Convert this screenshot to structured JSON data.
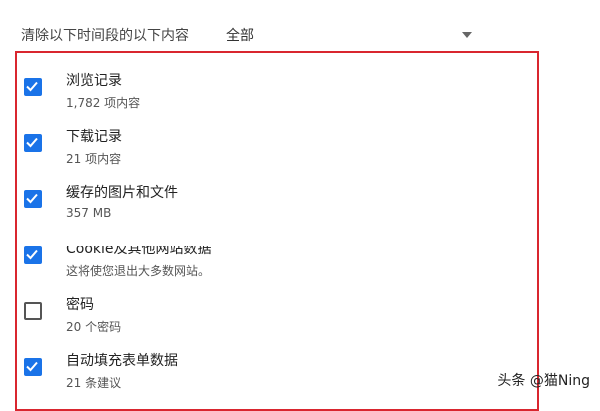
{
  "time_range": {
    "label": "清除以下时间段的以下内容",
    "value": "全部"
  },
  "items": [
    {
      "title": "浏览记录",
      "subtitle": "1,782 项内容",
      "checked": true
    },
    {
      "title": "下载记录",
      "subtitle": "21 项内容",
      "checked": true
    },
    {
      "title": "缓存的图片和文件",
      "subtitle": "357 MB",
      "checked": true
    },
    {
      "title": "Cookie及其他网站数据",
      "subtitle": "这将使您退出大多数网站。",
      "checked": true
    },
    {
      "title": "密码",
      "subtitle": "20 个密码",
      "checked": false
    },
    {
      "title": "自动填充表单数据",
      "subtitle": "21 条建议",
      "checked": true
    }
  ],
  "colors": {
    "checkbox_checked": "#1a73e8",
    "highlight_frame": "#d9262f"
  },
  "watermark": "头条 @猫Ning"
}
